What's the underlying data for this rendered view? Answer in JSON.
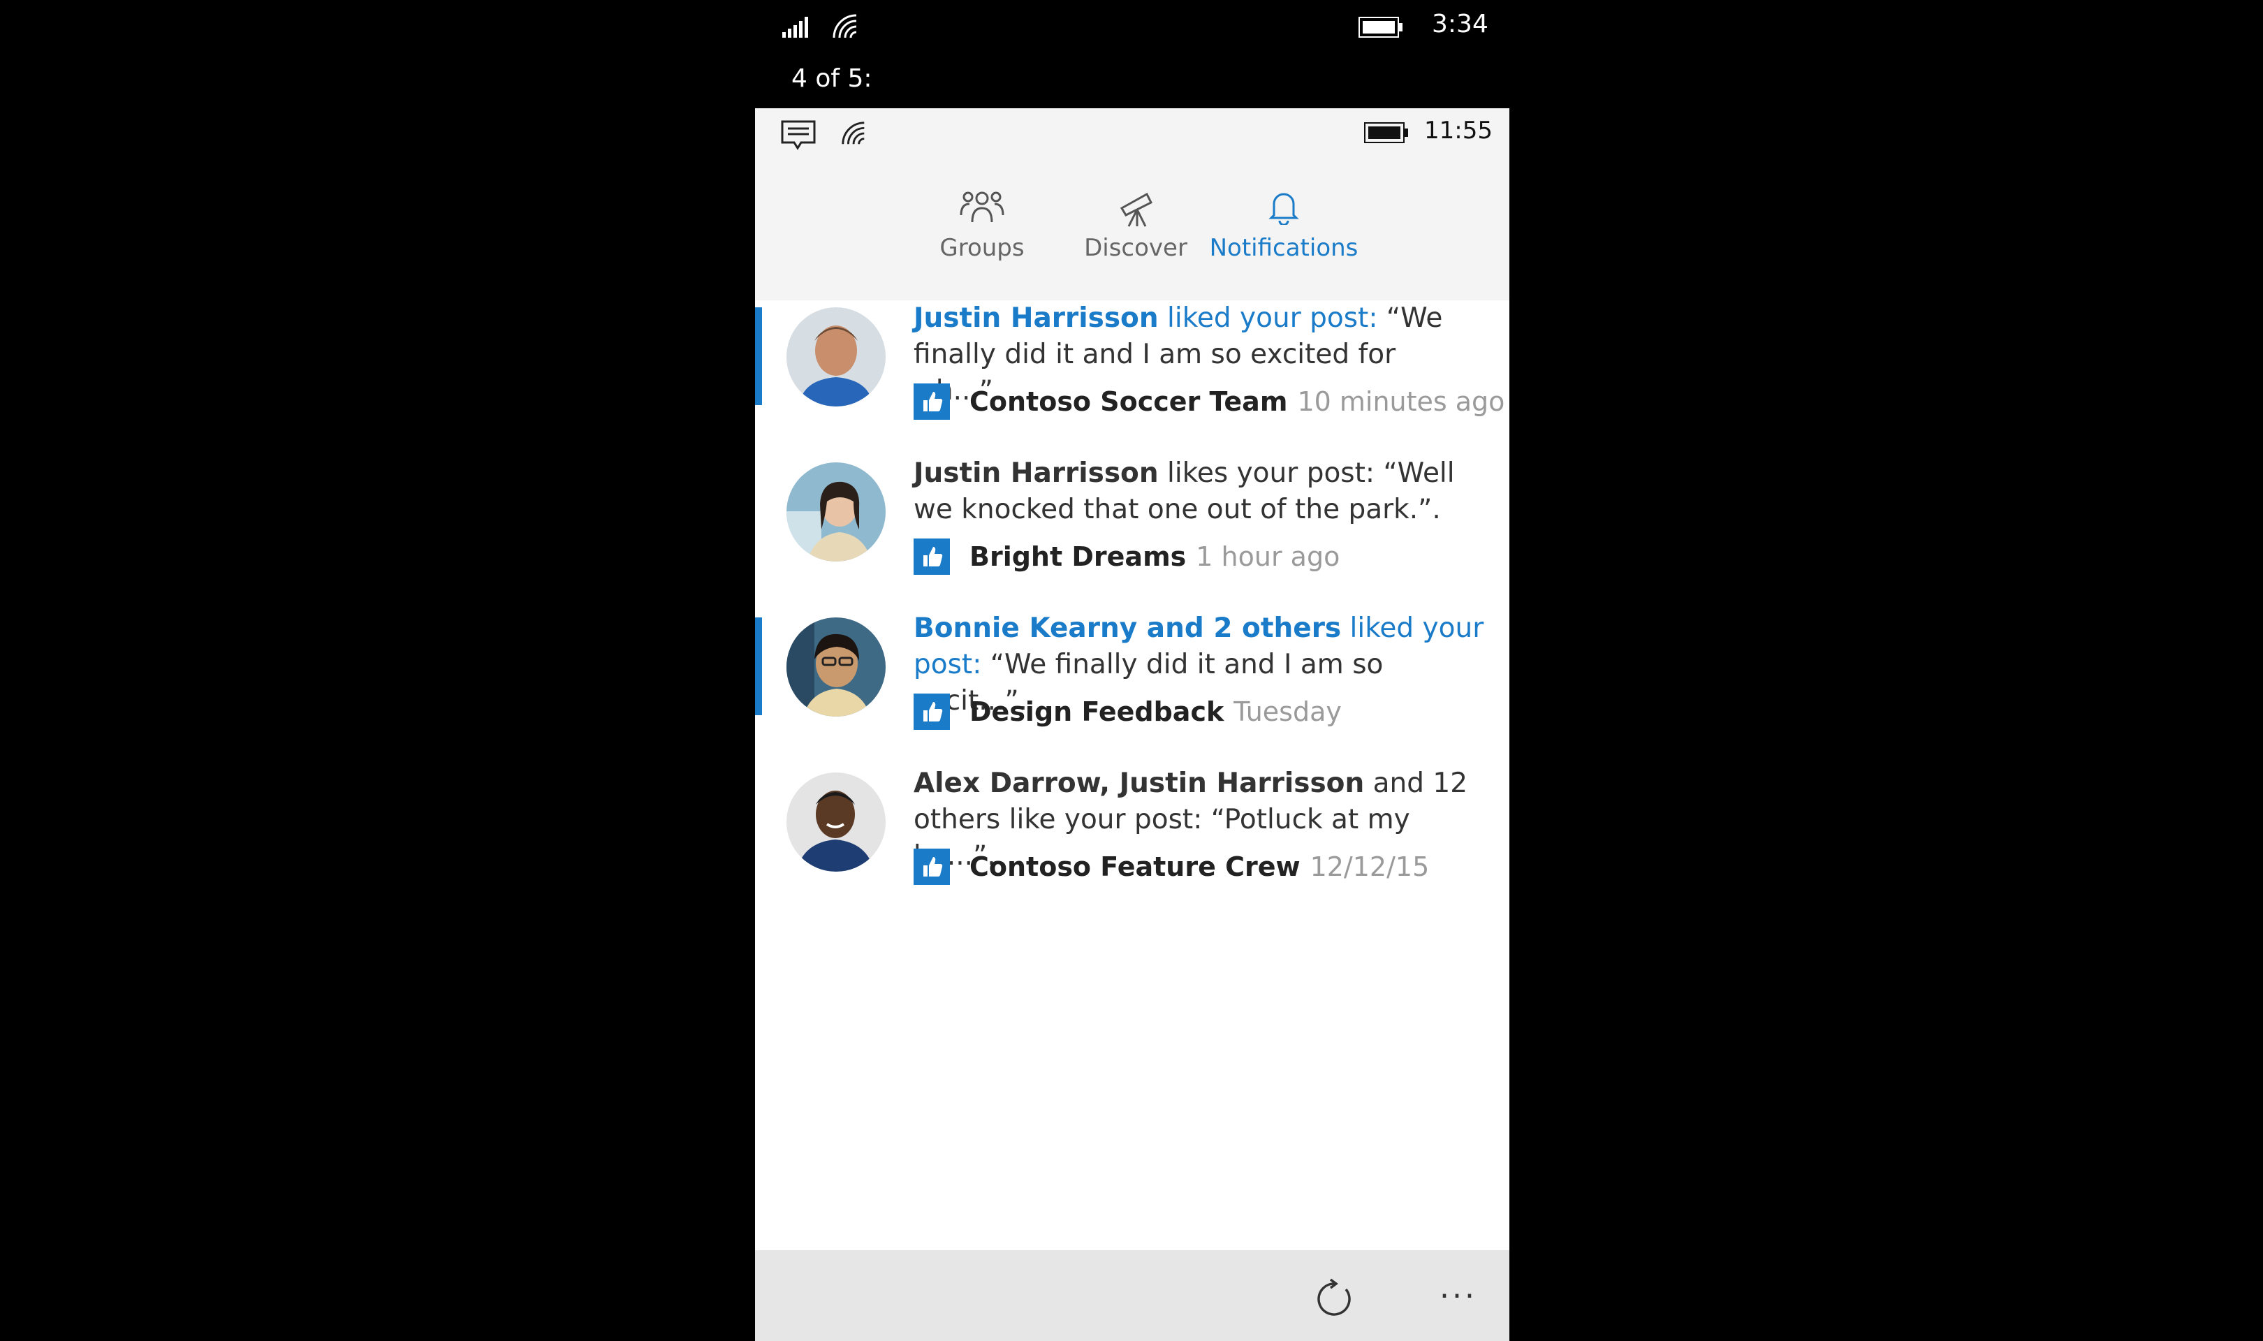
{
  "device": {
    "time": "3:34",
    "page_indicator": "4 of 5:"
  },
  "app": {
    "status_time": "11:55",
    "tabs": [
      {
        "label": "Groups",
        "icon": "groups-icon",
        "active": false
      },
      {
        "label": "Discover",
        "icon": "telescope-icon",
        "active": false
      },
      {
        "label": "Notifications",
        "icon": "bell-icon",
        "active": true
      }
    ],
    "accent_color": "#1a7bc9",
    "notifications": [
      {
        "unread": true,
        "name": "Justin Harrisson",
        "verb": " liked your post:",
        "quote": " “We finally did it and I am so excited for wh...”.",
        "group": "Contoso Soccer Team",
        "time": "10 minutes ago"
      },
      {
        "unread": false,
        "name": "Justin Harrisson",
        "verb": " likes your post:",
        "quote": " “Well we knocked that one out of the park.”.",
        "group": "Bright Dreams",
        "time": "1 hour ago"
      },
      {
        "unread": true,
        "name": "Bonnie Kearny and 2 others",
        "verb": " liked your post:",
        "quote": " “We finally did it and I am so excit...”.",
        "group": "Design Feedback",
        "time": "Tuesday"
      },
      {
        "unread": false,
        "name": "Alex Darrow, Justin Harrisson",
        "verb": " and 12 others like your post:",
        "quote": " “Potluck at my ho...”.",
        "group": "Contoso Feature Crew",
        "time": "12/12/15"
      }
    ],
    "appbar": {
      "refresh_icon": "refresh-icon",
      "more_label": "..."
    }
  }
}
